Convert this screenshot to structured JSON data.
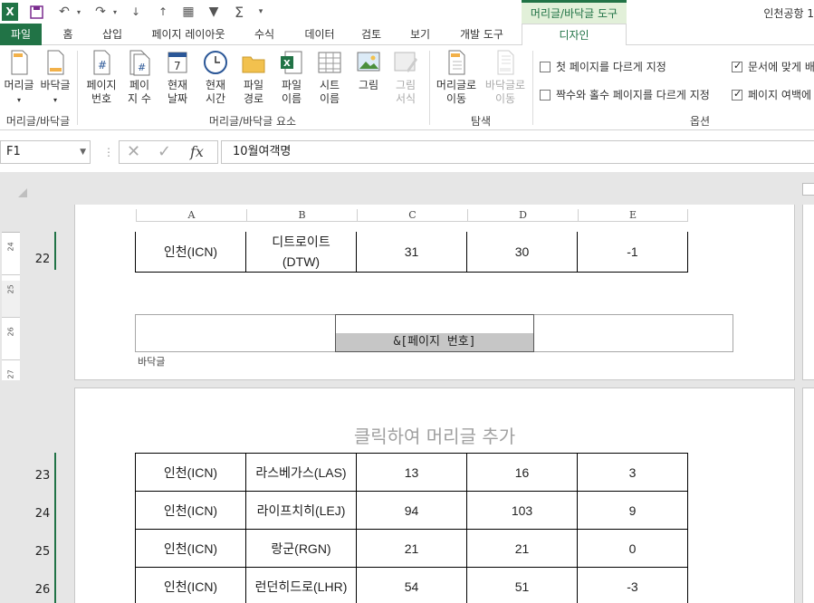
{
  "window": {
    "title": "인천공항 1",
    "context_tool": "머리글/바닥글 도구"
  },
  "quick_access": [
    {
      "name": "excel-logo-icon",
      "glyph": "X"
    },
    {
      "name": "save-icon",
      "glyph": "💾"
    },
    {
      "name": "undo-icon",
      "glyph": "↶"
    },
    {
      "name": "redo-icon",
      "glyph": "↷"
    }
  ],
  "tabs": [
    "파일",
    "홈",
    "삽입",
    "페이지 레이아웃",
    "수식",
    "데이터",
    "검토",
    "보기",
    "개발 도구",
    "디자인"
  ],
  "ribbon": {
    "groups": {
      "header_footer": "머리글/바닥글",
      "elements": "머리글/바닥글 요소",
      "navigation": "탐색",
      "options": "옵션"
    },
    "buttons": {
      "header": "머리글",
      "footer": "바닥글",
      "page_number_1": "페이지",
      "page_number_2": "번호",
      "page_count_1": "페이",
      "page_count_2": "지 수",
      "current_date_1": "현재",
      "current_date_2": "날짜",
      "current_time_1": "현재",
      "current_time_2": "시간",
      "file_path_1": "파일",
      "file_path_2": "경로",
      "file_name_1": "파일",
      "file_name_2": "이름",
      "sheet_name_1": "시트",
      "sheet_name_2": "이름",
      "picture": "그림",
      "format_picture_1": "그림",
      "format_picture_2": "서식",
      "goto_header_1": "머리글로",
      "goto_header_2": "이동",
      "goto_footer_1": "바닥글로",
      "goto_footer_2": "이동"
    },
    "options": {
      "diff_first": {
        "label": "첫 페이지를 다르게 지정",
        "checked": false
      },
      "diff_odd_even": {
        "label": "짝수와 홀수 페이지를 다르게 지정",
        "checked": false
      },
      "scale_with_doc": {
        "label": "문서에 맞게 배",
        "checked": true
      },
      "align_margins": {
        "label": "페이지 여백에",
        "checked": true
      }
    }
  },
  "formula_bar": {
    "name_box": "F1",
    "formula": "10월여객명",
    "fx": "fx"
  },
  "columns": [
    "A",
    "B",
    "C",
    "D",
    "E"
  ],
  "page1": {
    "rows": [
      {
        "num": "22",
        "cells": [
          "인천(ICN)",
          "디트로이트 (DTW)",
          "31",
          "30",
          "-1"
        ]
      }
    ],
    "ruler_marks": [
      "24",
      "25",
      "26",
      "27"
    ],
    "footer_code": "&[페이지 번호]",
    "footer_label": "바닥글"
  },
  "page2": {
    "header_placeholder": "클릭하여 머리글 추가",
    "rows": [
      {
        "num": "23",
        "cells": [
          "인천(ICN)",
          "라스베가스(LAS)",
          "13",
          "16",
          "3"
        ]
      },
      {
        "num": "24",
        "cells": [
          "인천(ICN)",
          "라이프치히(LEJ)",
          "94",
          "103",
          "9"
        ]
      },
      {
        "num": "25",
        "cells": [
          "인천(ICN)",
          "랑군(RGN)",
          "21",
          "21",
          "0"
        ]
      },
      {
        "num": "26",
        "cells": [
          "인천(ICN)",
          "런던히드로(LHR)",
          "54",
          "51",
          "-3"
        ]
      }
    ]
  },
  "colors": {
    "accent": "#217346",
    "context_tab_bg": "#e2f0d9"
  }
}
